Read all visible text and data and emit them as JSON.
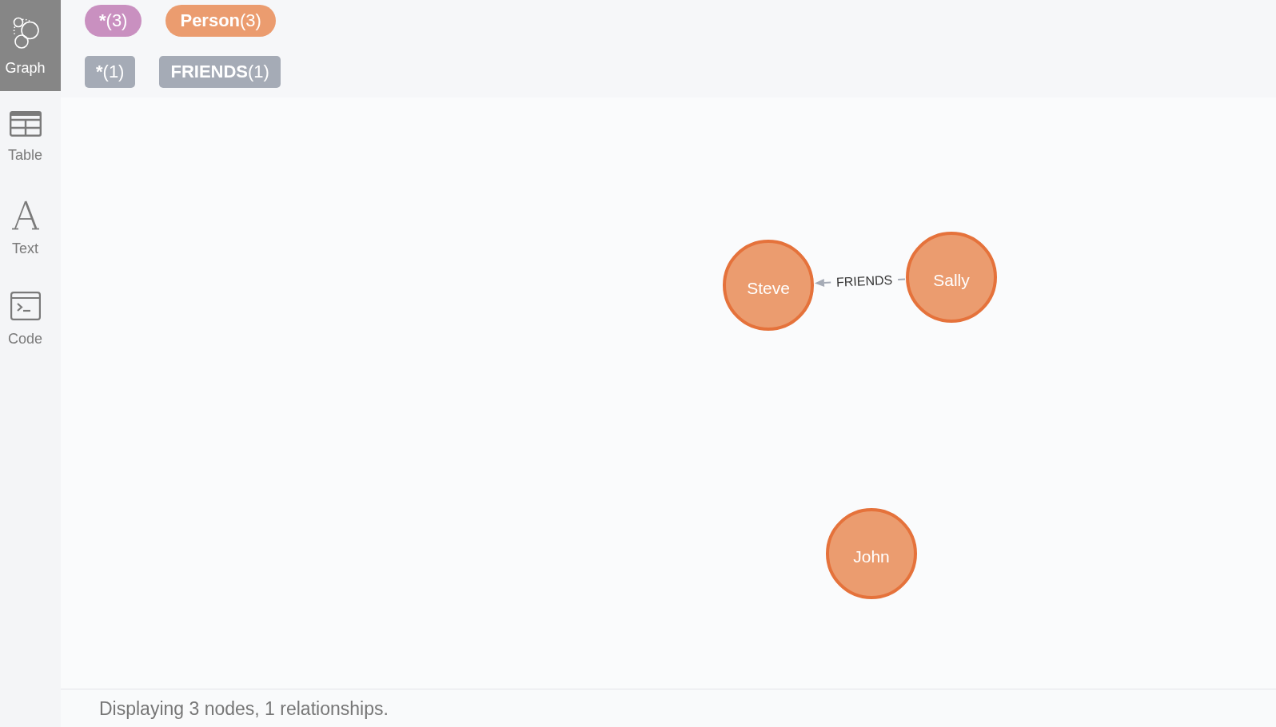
{
  "sidebar": {
    "items": [
      {
        "label": "Graph",
        "kind": "graph",
        "selected": true
      },
      {
        "label": "Table",
        "kind": "table",
        "selected": false
      },
      {
        "label": "Text",
        "kind": "text",
        "selected": false
      },
      {
        "label": "Code",
        "kind": "code",
        "selected": false
      }
    ]
  },
  "legend": {
    "node_labels": [
      {
        "label": "*",
        "count": "(3)",
        "color": "#c990c0"
      },
      {
        "label": "Person",
        "count": "(3)",
        "color": "#eb9c6f"
      }
    ],
    "relationship_types": [
      {
        "label": "*",
        "count": "(1)"
      },
      {
        "label": "FRIENDS",
        "count": "(1)"
      }
    ]
  },
  "graph": {
    "nodes": [
      {
        "name": "Steve"
      },
      {
        "name": "Sally"
      },
      {
        "name": "John"
      }
    ],
    "relationships": [
      {
        "type": "FRIENDS"
      }
    ]
  },
  "status_bar": {
    "text": "Displaying 3 nodes, 1 relationships."
  }
}
